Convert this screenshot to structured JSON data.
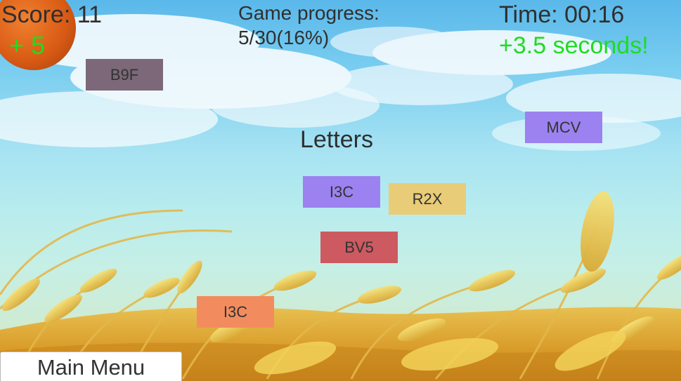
{
  "hud": {
    "score_label": "Score: 11",
    "score_bonus": "+ 5",
    "progress_label": "Game progress:",
    "progress_value": "5/30(16%)",
    "time_label": "Time: 00:16",
    "time_bonus": "+3.5 seconds!"
  },
  "category": {
    "title": "Letters"
  },
  "tiles": [
    {
      "label": "B9F",
      "color": "#7c6878"
    },
    {
      "label": "MCV",
      "color": "#9b82f0"
    },
    {
      "label": "I3C",
      "color": "#9b82f0"
    },
    {
      "label": "R2X",
      "color": "#e8cc78"
    },
    {
      "label": "BV5",
      "color": "#cc5a60"
    },
    {
      "label": "I3C",
      "color": "#f28c5e"
    }
  ],
  "menu": {
    "main_menu_label": "Main Menu"
  },
  "colors": {
    "bonus_green": "#1fdc1f",
    "sun_orange": "#e06a1a",
    "hud_text": "#2f2f2f"
  }
}
